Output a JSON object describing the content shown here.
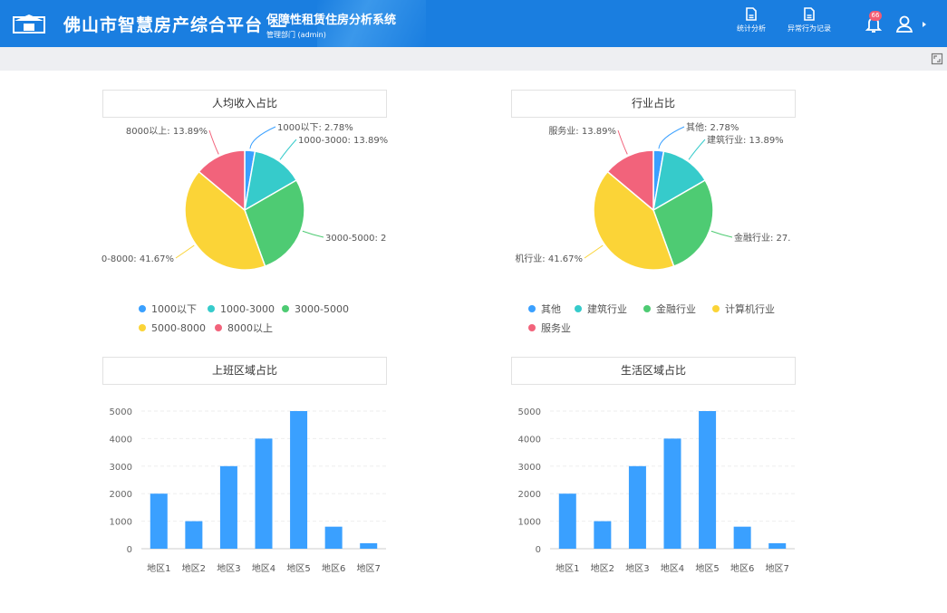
{
  "header": {
    "title": "佛山市智慧房产综合平台 —",
    "subtitle": "保障性租赁住房分析系统",
    "department": "管理部门 (admin)",
    "nav": [
      {
        "label": "统计分析",
        "icon": "document-icon"
      },
      {
        "label": "异常行为记录",
        "icon": "document-icon"
      }
    ],
    "notification_count": "66",
    "colors": {
      "bar": "#1a7ee0",
      "badge": "#f25c73"
    }
  },
  "panels": {
    "income": {
      "title": "人均收入占比"
    },
    "industry": {
      "title": "行业占比"
    },
    "work_area": {
      "title": "上班区域占比"
    },
    "life_area": {
      "title": "生活区域占比"
    }
  },
  "chart_data": [
    {
      "type": "pie",
      "title": "人均收入占比",
      "labels": [
        "1000以下",
        "1000-3000",
        "3000-5000",
        "5000-8000",
        "8000以上"
      ],
      "values": [
        2.78,
        13.89,
        27.78,
        41.67,
        13.89
      ],
      "slice_labels": [
        "1000以下: 2.78%",
        "1000-3000: 13.89%",
        "3000-5000: 2",
        "0-8000: 41.67%",
        "8000以上: 13.89%"
      ],
      "colors": [
        "#3aa0ff",
        "#36cbcb",
        "#4ecb73",
        "#fbd437",
        "#f2637b"
      ],
      "legend": "bottom"
    },
    {
      "type": "pie",
      "title": "行业占比",
      "labels": [
        "其他",
        "建筑行业",
        "金融行业",
        "计算机行业",
        "服务业"
      ],
      "values": [
        2.78,
        13.89,
        27.78,
        41.67,
        13.89
      ],
      "slice_labels": [
        "其他: 2.78%",
        "建筑行业: 13.89%",
        "金融行业: 27.",
        "机行业: 41.67%",
        "服务业: 13.89%"
      ],
      "colors": [
        "#3aa0ff",
        "#36cbcb",
        "#4ecb73",
        "#fbd437",
        "#f2637b"
      ],
      "legend": "bottom"
    },
    {
      "type": "bar",
      "title": "上班区域占比",
      "categories": [
        "地区1",
        "地区2",
        "地区3",
        "地区4",
        "地区5",
        "地区6",
        "地区7"
      ],
      "values": [
        2000,
        1000,
        3000,
        4000,
        5000,
        800,
        200
      ],
      "ylim": [
        0,
        5000
      ],
      "yticks": [
        0,
        1000,
        2000,
        3000,
        4000,
        5000
      ],
      "grid": true,
      "color": "#3aa0ff"
    },
    {
      "type": "bar",
      "title": "生活区域占比",
      "categories": [
        "地区1",
        "地区2",
        "地区3",
        "地区4",
        "地区5",
        "地区6",
        "地区7"
      ],
      "values": [
        2000,
        1000,
        3000,
        4000,
        5000,
        800,
        200
      ],
      "ylim": [
        0,
        5000
      ],
      "yticks": [
        0,
        1000,
        2000,
        3000,
        4000,
        5000
      ],
      "grid": true,
      "color": "#3aa0ff"
    }
  ]
}
